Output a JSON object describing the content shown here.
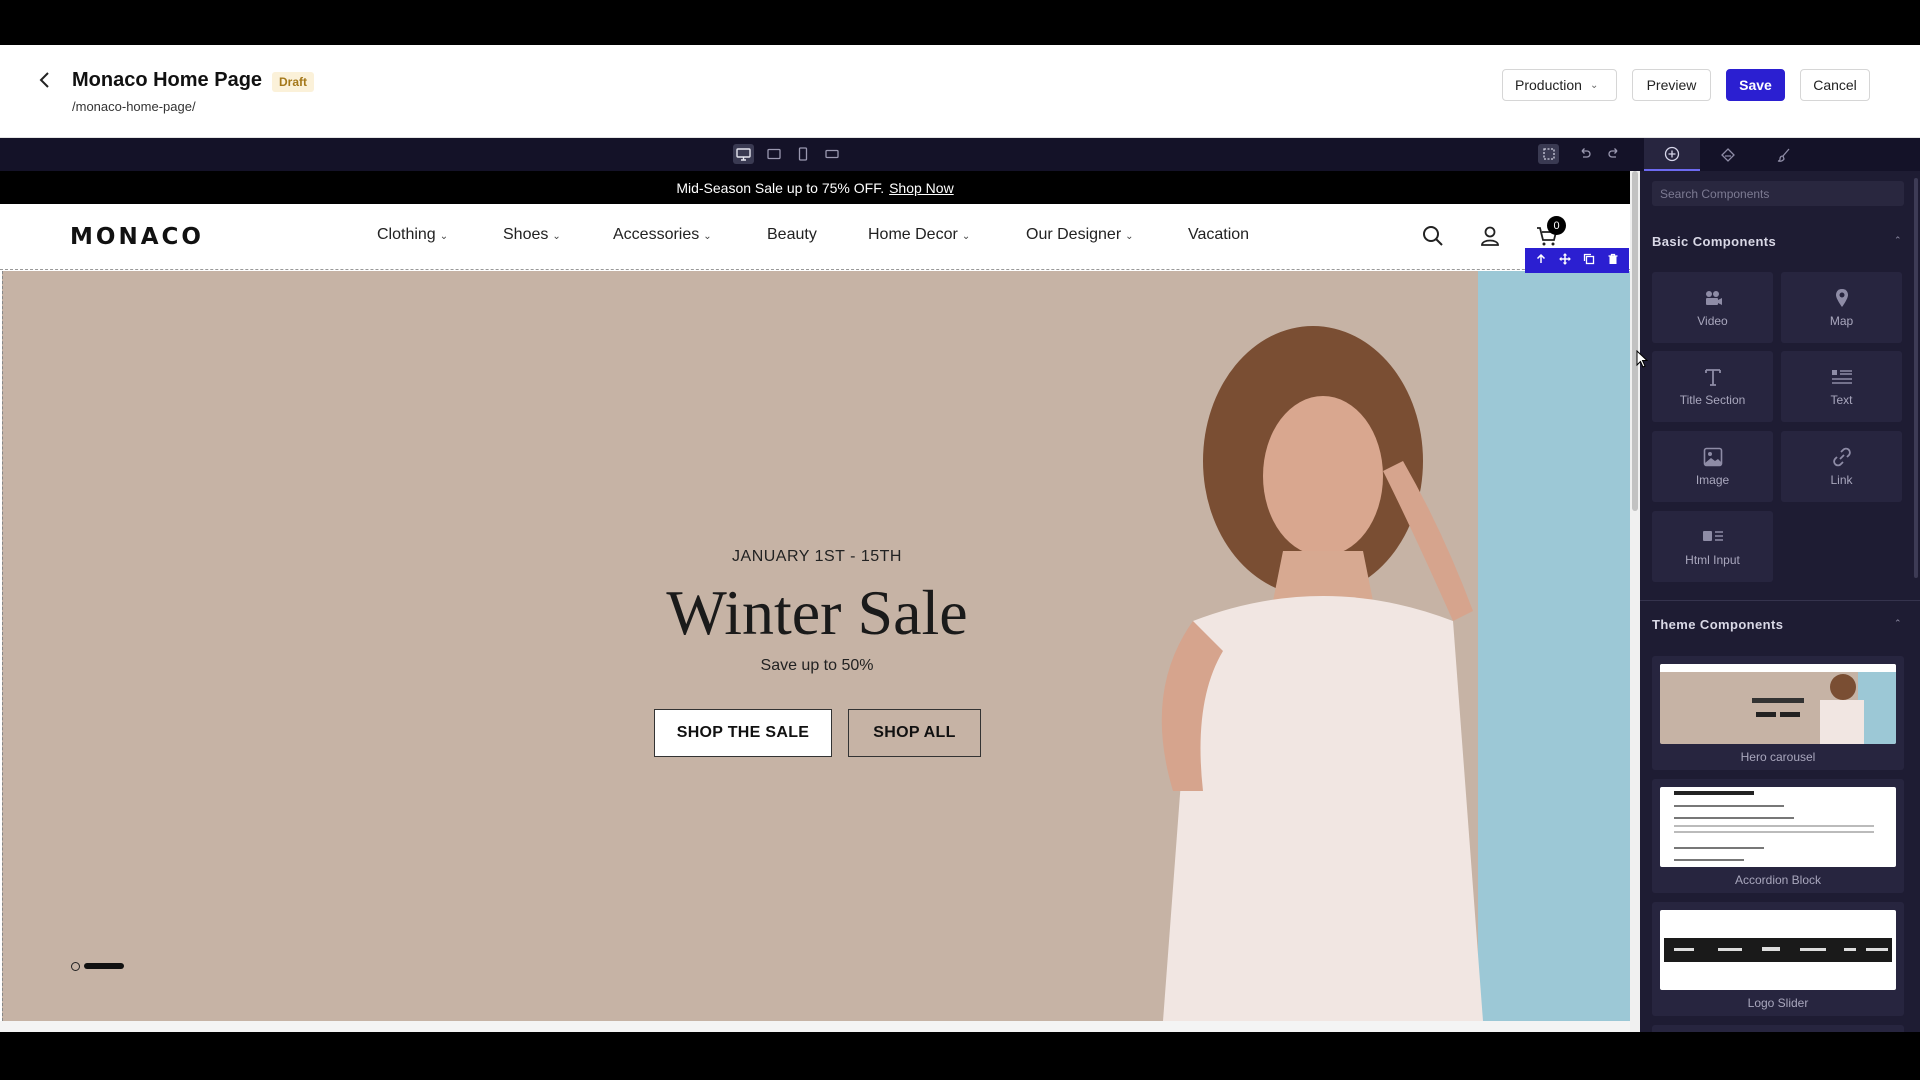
{
  "header": {
    "title": "Monaco Home Page",
    "badge": "Draft",
    "path": "/monaco-home-page/",
    "environment": "Production",
    "preview_label": "Preview",
    "save_label": "Save",
    "cancel_label": "Cancel"
  },
  "colors": {
    "accent": "#2b1fd1",
    "panel_bg": "#1e1c33",
    "toolbar_bg": "#141228",
    "hero_bg": "#c6b3a5"
  },
  "toolbar": {
    "device_icons": [
      "desktop-icon",
      "tablet-landscape-icon",
      "mobile-icon",
      "mobile-landscape-icon"
    ],
    "action_icons": [
      "select-frame-icon",
      "undo-icon",
      "redo-icon"
    ]
  },
  "panel": {
    "tabs": [
      "add-icon",
      "layers-icon",
      "paint-brush-icon"
    ],
    "search_placeholder": "Search Components",
    "basic_title": "Basic Components",
    "basic": [
      {
        "label": "Video",
        "icon": "video-icon"
      },
      {
        "label": "Map",
        "icon": "map-pin-icon"
      },
      {
        "label": "Title Section",
        "icon": "title-icon"
      },
      {
        "label": "Text",
        "icon": "text-icon"
      },
      {
        "label": "Image",
        "icon": "image-icon"
      },
      {
        "label": "Link",
        "icon": "link-icon"
      },
      {
        "label": "Html Input",
        "icon": "html-icon"
      }
    ],
    "theme_title": "Theme Components",
    "theme": [
      {
        "label": "Hero carousel"
      },
      {
        "label": "Accordion Block"
      },
      {
        "label": "Logo Slider"
      }
    ]
  },
  "site": {
    "promo_text": "Mid-Season Sale up to 75% OFF.",
    "promo_link": "Shop Now",
    "logo": "MONACO",
    "nav": [
      {
        "label": "Clothing",
        "dropdown": true
      },
      {
        "label": "Shoes",
        "dropdown": true
      },
      {
        "label": "Accessories",
        "dropdown": true
      },
      {
        "label": "Beauty",
        "dropdown": false
      },
      {
        "label": "Home Decor",
        "dropdown": true
      },
      {
        "label": "Our Designer",
        "dropdown": true
      },
      {
        "label": "Vacation",
        "dropdown": false
      }
    ],
    "cart_count": "0",
    "edit_icons": [
      "arrow-up-icon",
      "move-icon",
      "duplicate-icon",
      "trash-icon"
    ]
  },
  "hero": {
    "date": "JANUARY 1ST - 15TH",
    "title": "Winter Sale",
    "subtitle": "Save up to 50%",
    "btn_primary": "SHOP THE SALE",
    "btn_secondary": "SHOP ALL",
    "active_slide": 2,
    "slide_count": 2
  }
}
